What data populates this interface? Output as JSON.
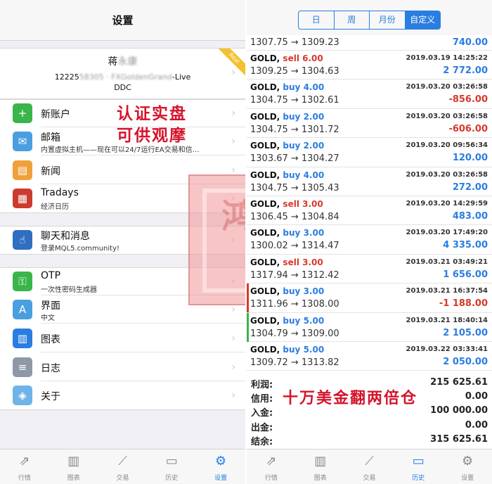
{
  "left": {
    "title": "设置",
    "account": {
      "name": "蒋",
      "name_blur": "永康",
      "number_prefix": "12225",
      "number_blur": "58305 · FXGoldenGrand",
      "server_suffix": "-Live",
      "sub": "DDC",
      "ribbon": "Real"
    },
    "menu": [
      {
        "label": "新账户",
        "sub": "",
        "icon": "add-user-icon",
        "color": "#3ab54a",
        "glyph": "+"
      },
      {
        "label": "邮箱",
        "sub": "内置虚拟主机——现在可以24/7运行EA交易和信…",
        "icon": "mail-icon",
        "color": "#4a9fe0",
        "glyph": "✉"
      },
      {
        "label": "新闻",
        "sub": "",
        "icon": "book-icon",
        "color": "#f0a03a",
        "glyph": "▤"
      },
      {
        "label": "Tradays",
        "sub": "经济日历",
        "icon": "calendar-icon",
        "color": "#cc3b2e",
        "glyph": "▦"
      },
      {
        "label": "聊天和消息",
        "sub": "登录MQL5.community!",
        "icon": "thumbs-up-icon",
        "color": "#2f6ec0",
        "glyph": "☝"
      },
      {
        "label": "OTP",
        "sub": "一次性密码生成器",
        "icon": "key-icon",
        "color": "#3ab54a",
        "glyph": "⚿"
      },
      {
        "label": "界面",
        "sub": "中文",
        "icon": "translate-icon",
        "color": "#4a9fe0",
        "glyph": "A"
      },
      {
        "label": "图表",
        "sub": "",
        "icon": "candles-icon",
        "color": "#2a7de1",
        "glyph": "▥"
      },
      {
        "label": "日志",
        "sub": "",
        "icon": "log-icon",
        "color": "#8e98a6",
        "glyph": "≡"
      },
      {
        "label": "关于",
        "sub": "",
        "icon": "about-icon",
        "color": "#6fb4e8",
        "glyph": "◈"
      }
    ],
    "overlay_line1": "认证实盘",
    "overlay_line2": "可供观摩",
    "stamp_text": "鸿印",
    "tabs": [
      {
        "label": "行情",
        "icon": "quotes-icon",
        "glyph": "⇗"
      },
      {
        "label": "图表",
        "icon": "chart-icon",
        "glyph": "▥"
      },
      {
        "label": "交易",
        "icon": "trade-icon",
        "glyph": "⟋"
      },
      {
        "label": "历史",
        "icon": "history-icon",
        "glyph": "▭"
      },
      {
        "label": "设置",
        "icon": "gear-icon",
        "glyph": "⚙"
      }
    ],
    "active_tab": 4
  },
  "right": {
    "segments": [
      "日",
      "周",
      "月份",
      "自定义"
    ],
    "active_segment": 3,
    "first_row": {
      "price": "1307.75 → 1309.23",
      "profit": "740.00"
    },
    "deals": [
      {
        "symbol": "GOLD",
        "side": "sell",
        "lots": "6.00",
        "time": "2019.03.19 14:25:22",
        "price": "1309.25 → 1304.63",
        "profit": "2 772.00",
        "neg": false
      },
      {
        "symbol": "GOLD",
        "side": "buy",
        "lots": "4.00",
        "time": "2019.03.20 03:26:58",
        "price": "1304.75 → 1302.61",
        "profit": "-856.00",
        "neg": true
      },
      {
        "symbol": "GOLD",
        "side": "buy",
        "lots": "2.00",
        "time": "2019.03.20 03:26:58",
        "price": "1304.75 → 1301.72",
        "profit": "-606.00",
        "neg": true
      },
      {
        "symbol": "GOLD",
        "side": "buy",
        "lots": "2.00",
        "time": "2019.03.20 09:56:34",
        "price": "1303.67 → 1304.27",
        "profit": "120.00",
        "neg": false
      },
      {
        "symbol": "GOLD",
        "side": "buy",
        "lots": "4.00",
        "time": "2019.03.20 03:26:58",
        "price": "1304.75 → 1305.43",
        "profit": "272.00",
        "neg": false
      },
      {
        "symbol": "GOLD",
        "side": "sell",
        "lots": "3.00",
        "time": "2019.03.20 14:29:59",
        "price": "1306.45 → 1304.84",
        "profit": "483.00",
        "neg": false
      },
      {
        "symbol": "GOLD",
        "side": "buy",
        "lots": "3.00",
        "time": "2019.03.20 17:49:20",
        "price": "1300.02 → 1314.47",
        "profit": "4 335.00",
        "neg": false
      },
      {
        "symbol": "GOLD",
        "side": "sell",
        "lots": "3.00",
        "time": "2019.03.21 03:49:21",
        "price": "1317.94 → 1312.42",
        "profit": "1 656.00",
        "neg": false
      },
      {
        "symbol": "GOLD",
        "side": "buy",
        "lots": "3.00",
        "time": "2019.03.21 16:37:54",
        "price": "1311.96 → 1308.00",
        "profit": "-1 188.00",
        "neg": true,
        "bar": "#d6392b"
      },
      {
        "symbol": "GOLD",
        "side": "buy",
        "lots": "5.00",
        "time": "2019.03.21 18:40:14",
        "price": "1304.79 → 1309.00",
        "profit": "2 105.00",
        "neg": false,
        "bar": "#3ab54a"
      },
      {
        "symbol": "GOLD",
        "side": "buy",
        "lots": "5.00",
        "time": "2019.03.22 03:33:41",
        "price": "1309.72 → 1313.82",
        "profit": "2 050.00",
        "neg": false
      }
    ],
    "summary": [
      {
        "key": "利润:",
        "value": "215 625.61"
      },
      {
        "key": "信用:",
        "value": "0.00"
      },
      {
        "key": "入金:",
        "value": "100 000.00"
      },
      {
        "key": "出金:",
        "value": "0.00"
      },
      {
        "key": "结余:",
        "value": "315 625.61"
      }
    ],
    "banner": "十万美金翻两倍仓",
    "tabs": [
      {
        "label": "行情",
        "icon": "quotes-icon",
        "glyph": "⇗"
      },
      {
        "label": "图表",
        "icon": "chart-icon",
        "glyph": "▥"
      },
      {
        "label": "交易",
        "icon": "trade-icon",
        "glyph": "⟋"
      },
      {
        "label": "历史",
        "icon": "history-icon",
        "glyph": "▭"
      },
      {
        "label": "设置",
        "icon": "gear-icon",
        "glyph": "⚙"
      }
    ],
    "active_tab": 3
  }
}
